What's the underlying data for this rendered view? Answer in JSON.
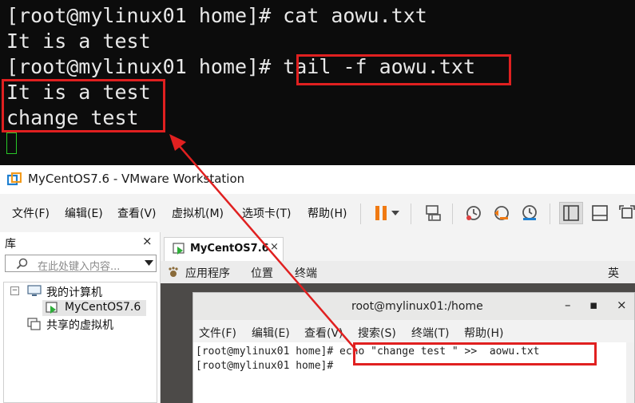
{
  "top_terminal": {
    "lines": [
      "[root@mylinux01 home]# cat aowu.txt",
      "It is a test",
      "[root@mylinux01 home]# ",
      "It is a test",
      "change test"
    ],
    "highlighted_command": "tail -f aowu.txt",
    "cursor_color": "#28c828",
    "highlight_color": "#e02020"
  },
  "vmware": {
    "title": "MyCentOS7.6 - VMware Workstation",
    "menu": [
      "文件(F)",
      "编辑(E)",
      "查看(V)",
      "虚拟机(M)",
      "选项卡(T)",
      "帮助(H)"
    ],
    "toolbar_icons": [
      "pause-icon",
      "dropdown-icon",
      "send-keys-icon",
      "snapshot-icon",
      "revert-snapshot-icon",
      "snapshot-manager-icon",
      "sidebar-view-icon",
      "console-view-icon",
      "fullscreen-icon"
    ],
    "library": {
      "title": "库",
      "close": "×",
      "search_placeholder": "在此处键入内容...",
      "tree": {
        "root": "我的计算机",
        "vm": "MyCentOS7.6",
        "shared": "共享的虚拟机",
        "expand_symbol": "−"
      }
    },
    "tab": {
      "label": "MyCentOS7.6",
      "close": "×"
    },
    "gnome_bar": {
      "apps": "应用程序",
      "places": "位置",
      "terminal": "终端",
      "ime": "英"
    },
    "inner_terminal": {
      "title": "root@mylinux01:/home",
      "controls": [
        "–",
        "▪",
        "×"
      ],
      "menu": [
        "文件(F)",
        "编辑(E)",
        "查看(V)",
        "搜索(S)",
        "终端(T)",
        "帮助(H)"
      ],
      "prompt": "[root@mylinux01 home]#",
      "command": "echo \"change test \" >>  aowu.txt"
    }
  }
}
